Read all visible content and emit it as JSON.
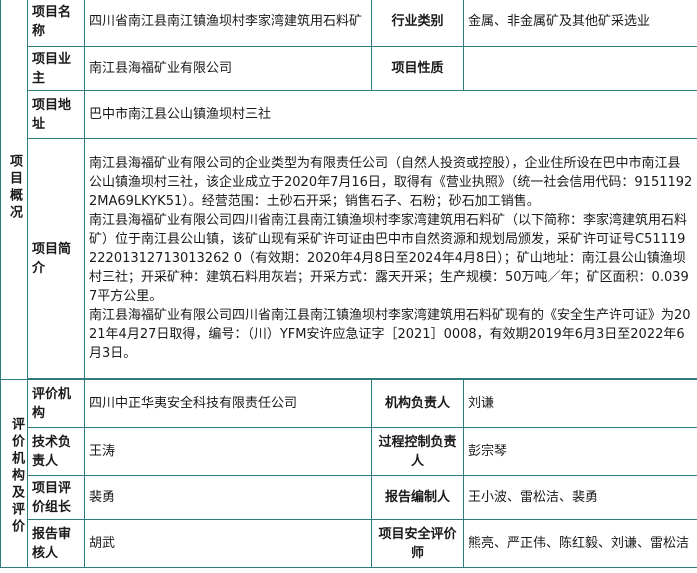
{
  "overview": {
    "section_label": "项目概况",
    "name_label": "项目名称",
    "name_value": "四川省南江县南江镇渔坝村李家湾建筑用石料矿",
    "industry_label": "行业类别",
    "industry_value": "金属、非金属矿及其他矿采选业",
    "owner_label": "项目业主",
    "owner_value": "南江县海福矿业有限公司",
    "nature_label": "项目性质",
    "nature_value": "",
    "address_label": "项目地址",
    "address_value": "巴中市南江县公山镇渔坝村三社",
    "intro_label": "项目简介",
    "intro_paragraphs": [
      "南江县海福矿业有限公司的企业类型为有限责任公司（自然人投资或控股），企业住所设在巴中市南江县公山镇渔坝村三社，该企业成立于2020年7月16日，取得有《营业执照》（统一社会信用代码：91511922MA69LKYK51）。经营范围：土砂石开采；销售石子、石粉；砂石加工销售。",
      "南江县海福矿业有限公司四川省南江县南江镇渔坝村李家湾建筑用石料矿（以下简称：李家湾建筑用石料矿）位于南江县公山镇，该矿山现有采矿许可证由巴中市自然资源和规划局颁发，采矿许可证号C5111922201312713013262 0（有效期：2020年4月8日至2024年4月8日）；矿山地址：南江县公山镇渔坝村三社；开采矿种：建筑石料用灰岩；开采方式：露天开采；生产规模：50万吨／年；矿区面积：0.0397平方公里。",
      "南江县海福矿业有限公司四川省南江县南江镇渔坝村李家湾建筑用石料矿现有的《安全生产许可证》为2021年4月27日取得，编号：（川）YFM安许应急证字［2021］0008，有效期2019年6月3日至2022年6月3日。"
    ]
  },
  "evaluation": {
    "section_label": "评价机构及评价",
    "org_label": "评价机构",
    "org_value": "四川中正华夷安全科技有限责任公司",
    "org_head_label": "机构负责人",
    "org_head_value": "刘谦",
    "tech_head_label": "技术负责人",
    "tech_head_value": "王涛",
    "process_label": "过程控制负责人",
    "process_value": "彭宗琴",
    "leader_label": "项目评价组长",
    "leader_value": "裴勇",
    "report_author_label": "报告编制人",
    "report_author_value": "王小波、雷松洁、裴勇",
    "reviewer_label": "报告审核人",
    "reviewer_value": "胡武",
    "safety_eval_label": "项目安全评价师",
    "safety_eval_value": "熊亮、严正伟、陈红毅、刘谦、雷松洁"
  }
}
